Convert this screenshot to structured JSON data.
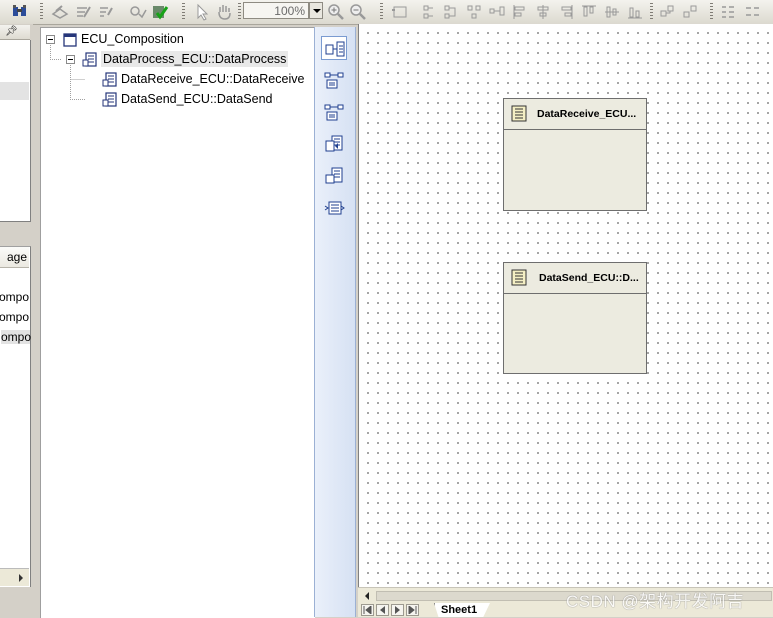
{
  "toolbar": {
    "zoom_value": "100%"
  },
  "left_panel": {
    "column_header": "age",
    "items": [
      "ompo",
      "ompo",
      "ompo"
    ]
  },
  "tree": {
    "root": "ECU_Composition",
    "items": [
      "DataProcess_ECU::DataProcess",
      "DataReceive_ECU::DataReceive",
      "DataSend_ECU::DataSend"
    ]
  },
  "canvas": {
    "components": [
      {
        "title": "DataReceive_ECU..."
      },
      {
        "title": "DataSend_ECU::D..."
      }
    ]
  },
  "sheet_tabs": [
    "Sheet1"
  ],
  "watermark": "CSDN @架构开发阿吉",
  "colors": {
    "component_fill": "#ecebe0",
    "palette_bg": "#d6e1f3",
    "toolbar_bg": "#dcd9cf"
  },
  "icons": {
    "toolbar": [
      "binoculars-icon",
      "edit-icon",
      "zoom-in-icon",
      "zoom-out-icon",
      "pointer-icon",
      "hand-icon"
    ],
    "palette": [
      "composition-icon",
      "port-connector-icon",
      "delegation-connector-icon",
      "component-prototype-icon",
      "sender-receiver-icon",
      "client-server-icon"
    ]
  }
}
